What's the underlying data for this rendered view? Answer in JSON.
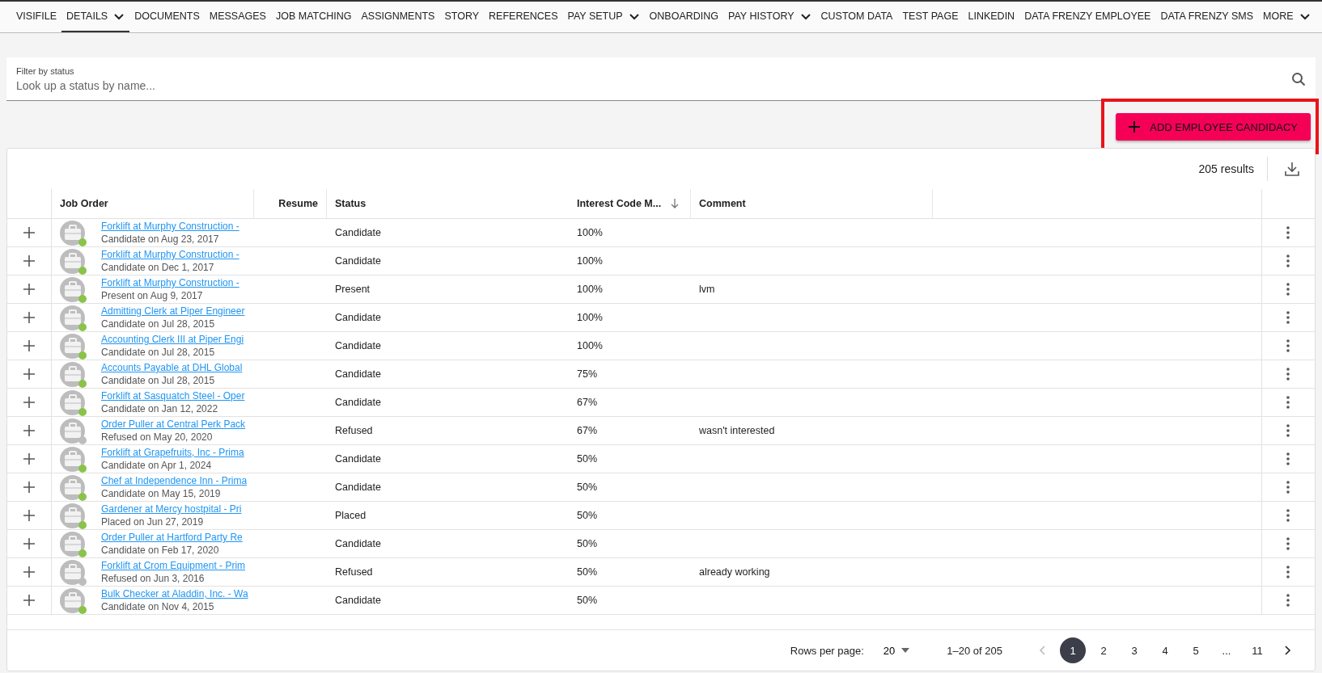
{
  "nav": {
    "tabs": [
      {
        "label": "VISIFILE",
        "selected": false,
        "dropdown": false
      },
      {
        "label": "DETAILS",
        "selected": true,
        "dropdown": true
      },
      {
        "label": "DOCUMENTS",
        "selected": false,
        "dropdown": false
      },
      {
        "label": "MESSAGES",
        "selected": false,
        "dropdown": false
      },
      {
        "label": "JOB MATCHING",
        "selected": false,
        "dropdown": false
      },
      {
        "label": "ASSIGNMENTS",
        "selected": false,
        "dropdown": false
      },
      {
        "label": "STORY",
        "selected": false,
        "dropdown": false
      },
      {
        "label": "REFERENCES",
        "selected": false,
        "dropdown": false
      },
      {
        "label": "PAY SETUP",
        "selected": false,
        "dropdown": true
      },
      {
        "label": "ONBOARDING",
        "selected": false,
        "dropdown": false
      },
      {
        "label": "PAY HISTORY",
        "selected": false,
        "dropdown": true
      },
      {
        "label": "CUSTOM DATA",
        "selected": false,
        "dropdown": false
      },
      {
        "label": "TEST PAGE",
        "selected": false,
        "dropdown": false
      },
      {
        "label": "LINKEDIN",
        "selected": false,
        "dropdown": false
      },
      {
        "label": "DATA FRENZY EMPLOYEE",
        "selected": false,
        "dropdown": false
      },
      {
        "label": "DATA FRENZY SMS",
        "selected": false,
        "dropdown": false
      },
      {
        "label": "MORE",
        "selected": false,
        "dropdown": true
      }
    ]
  },
  "filter": {
    "label": "Filter by status",
    "placeholder": "Look up a status by name..."
  },
  "add_button": {
    "label": "ADD EMPLOYEE CANDIDACY",
    "highlighted": true
  },
  "table": {
    "results": "205 results",
    "columns": [
      {
        "label": "Job Order",
        "sorted": false
      },
      {
        "label": "Resume",
        "sorted": false
      },
      {
        "label": "Status",
        "sorted": false
      },
      {
        "label": "Interest Code M...",
        "sorted": true
      },
      {
        "label": "Comment",
        "sorted": false
      }
    ],
    "rows": [
      {
        "job": "Forklift at Murphy Construction -",
        "sub": "Candidate on Aug 23, 2017",
        "color": "#8bc34a",
        "status": "Candidate",
        "interest": "100%",
        "comment": ""
      },
      {
        "job": "Forklift at Murphy Construction -",
        "sub": "Candidate on Dec 1, 2017",
        "color": "#8bc34a",
        "status": "Candidate",
        "interest": "100%",
        "comment": ""
      },
      {
        "job": "Forklift at Murphy Construction -",
        "sub": "Present on Aug 9, 2017",
        "color": "#8bc34a",
        "status": "Present",
        "interest": "100%",
        "comment": "lvm"
      },
      {
        "job": "Admitting Clerk at Piper Engineer",
        "sub": "Candidate on Jul 28, 2015",
        "color": "#8bc34a",
        "status": "Candidate",
        "interest": "100%",
        "comment": ""
      },
      {
        "job": "Accounting Clerk III at Piper Engi",
        "sub": "Candidate on Jul 28, 2015",
        "color": "#8bc34a",
        "status": "Candidate",
        "interest": "100%",
        "comment": ""
      },
      {
        "job": "Accounts Payable at DHL Global",
        "sub": "Candidate on Jul 28, 2015",
        "color": "#8bc34a",
        "status": "Candidate",
        "interest": "75%",
        "comment": ""
      },
      {
        "job": "Forklift at Sasquatch Steel - Oper",
        "sub": "Candidate on Jan 12, 2022",
        "color": "#8bc34a",
        "status": "Candidate",
        "interest": "67%",
        "comment": ""
      },
      {
        "job": "Order Puller at Central Perk Pack",
        "sub": "Refused on May 20, 2020",
        "color": "#bdbdbd",
        "status": "Refused",
        "interest": "67%",
        "comment": "wasn't interested"
      },
      {
        "job": "Forklift at Grapefruits, Inc - Prima",
        "sub": "Candidate on Apr 1, 2024",
        "color": "#8bc34a",
        "status": "Candidate",
        "interest": "50%",
        "comment": ""
      },
      {
        "job": "Chef at Independence Inn - Prima",
        "sub": "Candidate on May 15, 2019",
        "color": "#8bc34a",
        "status": "Candidate",
        "interest": "50%",
        "comment": ""
      },
      {
        "job": "Gardener at Mercy hostpital - Pri",
        "sub": "Placed on Jun 27, 2019",
        "color": "#8bc34a",
        "status": "Placed",
        "interest": "50%",
        "comment": ""
      },
      {
        "job": "Order Puller at Hartford Party Re",
        "sub": "Candidate on Feb 17, 2020",
        "color": "#8bc34a",
        "status": "Candidate",
        "interest": "50%",
        "comment": ""
      },
      {
        "job": "Forklift at Crom Equipment - Prim",
        "sub": "Refused on Jun 3, 2016",
        "color": "#bdbdbd",
        "status": "Refused",
        "interest": "50%",
        "comment": "already working"
      },
      {
        "job": "Bulk Checker at Aladdin, Inc. - Wa",
        "sub": "Candidate on Nov 4, 2015",
        "color": "#8bc34a",
        "status": "Candidate",
        "interest": "50%",
        "comment": ""
      }
    ]
  },
  "pagination": {
    "rows_label": "Rows per page:",
    "rows_value": "20",
    "range": "1–20 of 205",
    "prev_disabled": true,
    "pages": [
      {
        "label": "1",
        "selected": true
      },
      {
        "label": "2",
        "selected": false
      },
      {
        "label": "3",
        "selected": false
      },
      {
        "label": "4",
        "selected": false
      },
      {
        "label": "5",
        "selected": false
      },
      {
        "label": "...",
        "selected": false
      },
      {
        "label": "11",
        "selected": false
      }
    ]
  }
}
